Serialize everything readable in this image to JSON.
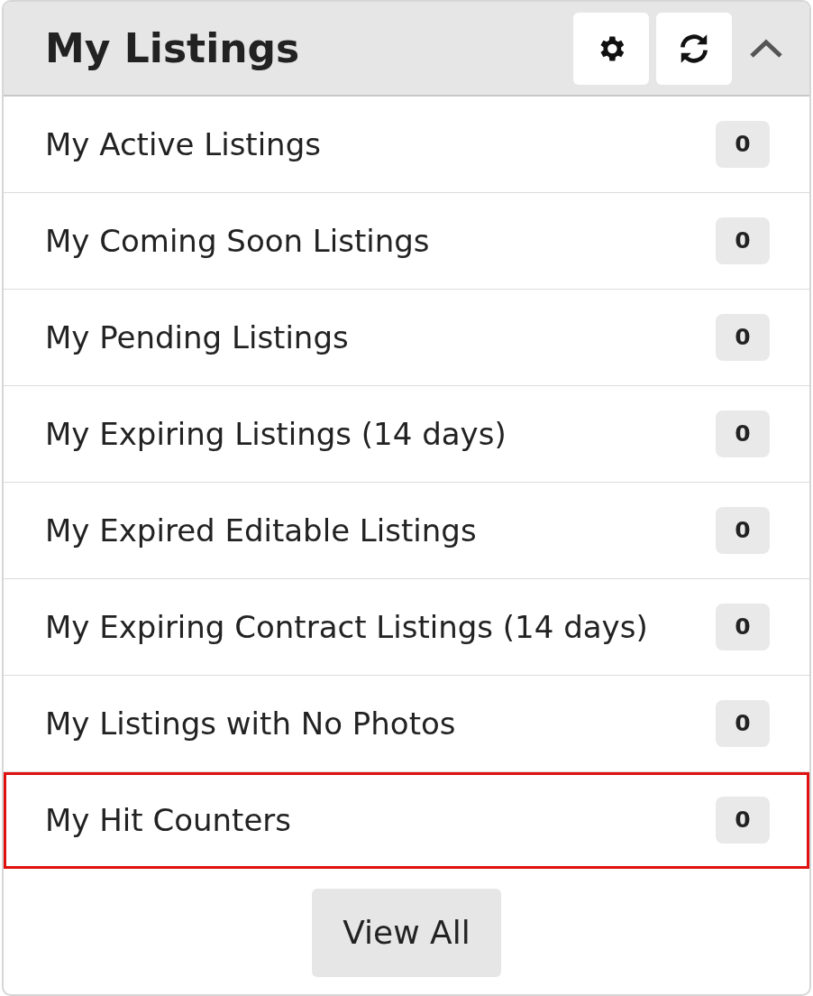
{
  "header": {
    "title": "My Listings",
    "collapse_expanded": true
  },
  "items": [
    {
      "label": "My Active Listings",
      "count": "0",
      "selected": false
    },
    {
      "label": "My Coming Soon Listings",
      "count": "0",
      "selected": false
    },
    {
      "label": "My Pending Listings",
      "count": "0",
      "selected": false
    },
    {
      "label": "My Expiring Listings (14 days)",
      "count": "0",
      "selected": false
    },
    {
      "label": "My Expired Editable Listings",
      "count": "0",
      "selected": false
    },
    {
      "label": "My Expiring Contract Listings (14 days)",
      "count": "0",
      "selected": false
    },
    {
      "label": "My Listings with No Photos",
      "count": "0",
      "selected": false
    },
    {
      "label": "My Hit Counters",
      "count": "0",
      "selected": true
    }
  ],
  "footer": {
    "button": "View All"
  }
}
